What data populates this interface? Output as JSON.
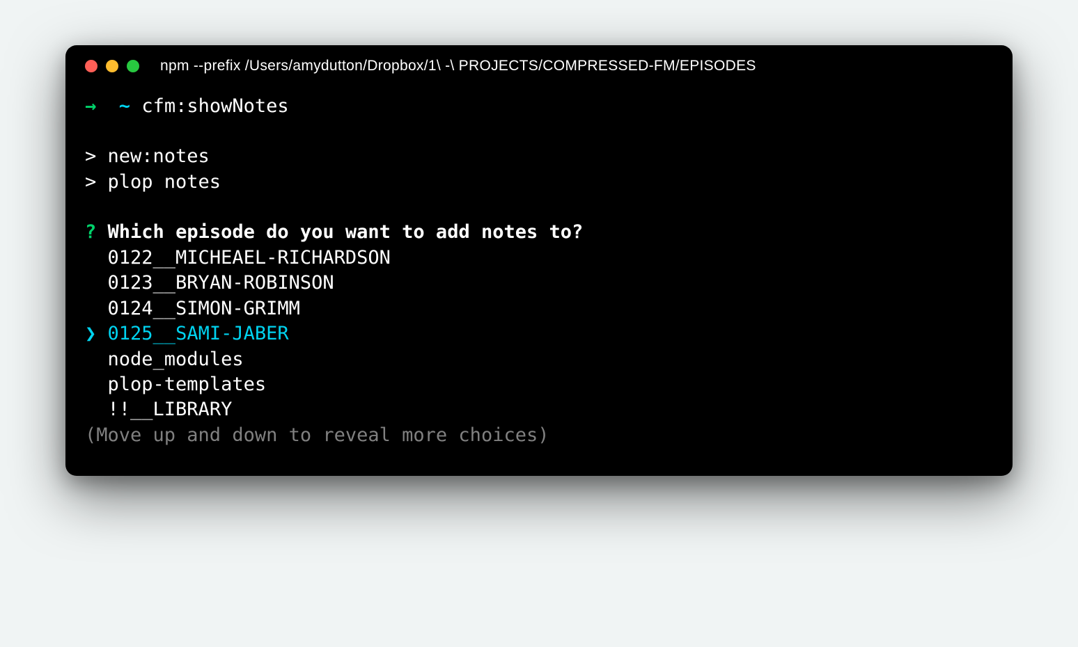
{
  "window": {
    "title": "npm --prefix /Users/amydutton/Dropbox/1\\ -\\ PROJECTS/COMPRESSED-FM/EPISODES"
  },
  "prompt": {
    "arrow": "→",
    "tilde": "~",
    "command": "cfm:showNotes"
  },
  "output": {
    "line1": "> new:notes",
    "line2": "> plop notes"
  },
  "prompt_interactive": {
    "marker": "?",
    "question": "Which episode do you want to add notes to?",
    "choices": [
      {
        "label": "0122__MICHEAEL-RICHARDSON",
        "selected": false
      },
      {
        "label": "0123__BRYAN-ROBINSON",
        "selected": false
      },
      {
        "label": "0124__SIMON-GRIMM",
        "selected": false
      },
      {
        "label": "0125__SAMI-JABER",
        "selected": true
      },
      {
        "label": "node_modules",
        "selected": false
      },
      {
        "label": "plop-templates",
        "selected": false
      },
      {
        "label": "!!__LIBRARY",
        "selected": false
      }
    ],
    "pointer": "❯",
    "hint": "(Move up and down to reveal more choices)"
  }
}
